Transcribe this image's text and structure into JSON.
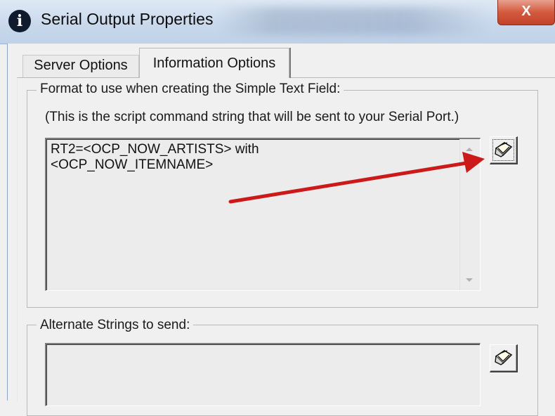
{
  "window": {
    "title": "Serial Output Properties",
    "close_glyph": "X",
    "icon": "info-icon"
  },
  "tabs": [
    {
      "label": "Server Options",
      "selected": false
    },
    {
      "label": "Information Options",
      "selected": true
    }
  ],
  "format_group": {
    "legend": "Format to use when creating the Simple Text Field:",
    "hint": "(This is the script command string that will be sent to your Serial Port.)",
    "script_text": "RT2=<OCP_NOW_ARTISTS> with\n<OCP_NOW_ITEMNAME>",
    "edit_button_icon": "edit-script-icon"
  },
  "alternate_group": {
    "legend": "Alternate Strings to send:",
    "text": "",
    "edit_button_icon": "edit-script-icon"
  },
  "annotation": {
    "type": "arrow",
    "color": "#cc1a1a"
  }
}
